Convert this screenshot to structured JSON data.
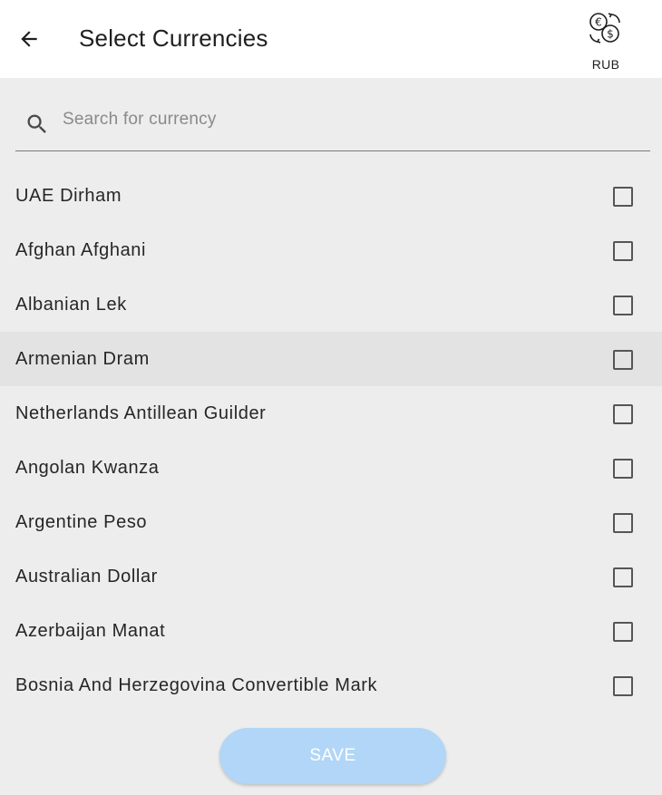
{
  "app_bar": {
    "title": "Select Currencies",
    "back_icon": "arrow-left-icon",
    "action_icon": "currency-exchange-icon",
    "action_label": "RUB"
  },
  "search": {
    "placeholder": "Search for currency",
    "value": "",
    "icon": "search-icon"
  },
  "currencies": [
    {
      "name": "UAE Dirham",
      "checked": false
    },
    {
      "name": "Afghan Afghani",
      "checked": false
    },
    {
      "name": "Albanian Lek",
      "checked": false
    },
    {
      "name": "Armenian Dram",
      "checked": false,
      "highlighted": true
    },
    {
      "name": "Netherlands Antillean Guilder",
      "checked": false
    },
    {
      "name": "Angolan Kwanza",
      "checked": false
    },
    {
      "name": "Argentine Peso",
      "checked": false
    },
    {
      "name": "Australian Dollar",
      "checked": false
    },
    {
      "name": "Azerbaijan Manat",
      "checked": false
    },
    {
      "name": "Bosnia And Herzegovina Convertible Mark",
      "checked": false
    }
  ],
  "save_button": {
    "label": "SAVE",
    "enabled": false
  },
  "colors": {
    "app_bar_bg": "#ffffff",
    "page_bg": "#ededed",
    "highlight_row_bg": "#e3e3e3",
    "save_button_bg": "#b1d6f7",
    "save_button_text": "#ffffff"
  }
}
